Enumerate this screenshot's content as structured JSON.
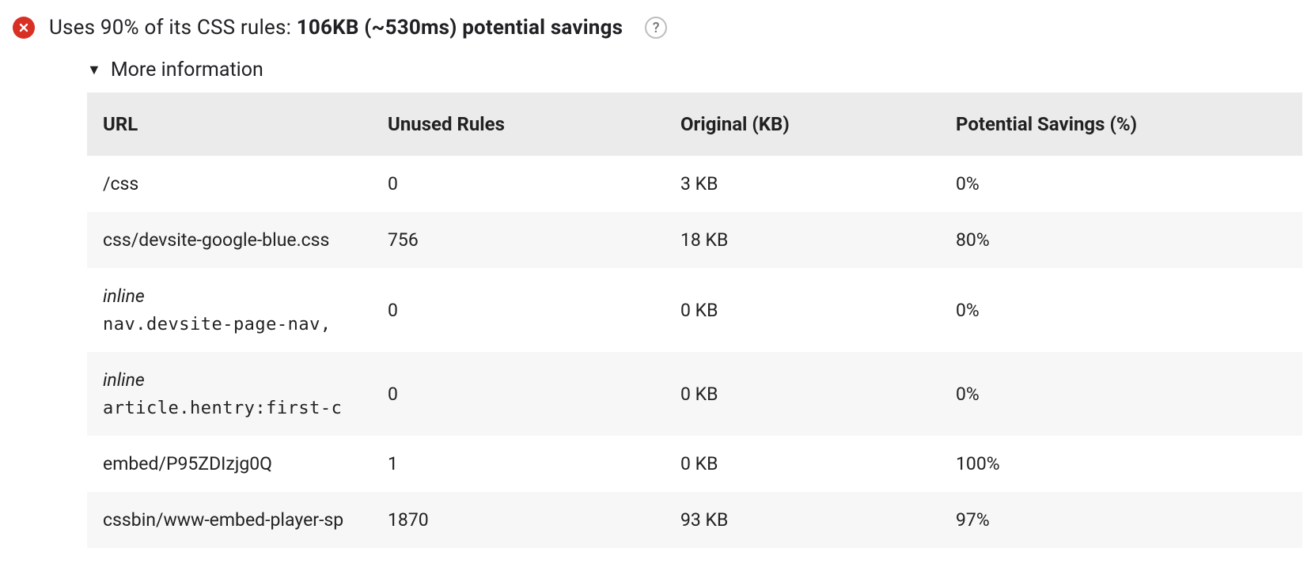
{
  "audit": {
    "title_prefix": "Uses 90% of its CSS rules: ",
    "title_bold": "106KB (~530ms) potential savings",
    "help_glyph": "?",
    "disclosure_label": "More information"
  },
  "table": {
    "headers": {
      "url": "URL",
      "unused": "Unused Rules",
      "original": "Original (KB)",
      "savings": "Potential Savings (%)"
    },
    "rows": [
      {
        "url": "/css",
        "unused": "0",
        "original": "3 KB",
        "savings": "0%"
      },
      {
        "url": "css/devsite-google-blue.css",
        "unused": "756",
        "original": "18 KB",
        "savings": "80%"
      },
      {
        "inline_label": "inline",
        "code": "nav.devsite-page-nav,",
        "unused": "0",
        "original": "0 KB",
        "savings": "0%"
      },
      {
        "inline_label": "inline",
        "code": "article.hentry:first-c",
        "unused": "0",
        "original": "0 KB",
        "savings": "0%"
      },
      {
        "url": "embed/P95ZDIzjg0Q",
        "unused": "1",
        "original": "0 KB",
        "savings": "100%"
      },
      {
        "url": "cssbin/www-embed-player-sp",
        "unused": "1870",
        "original": "93 KB",
        "savings": "97%"
      }
    ]
  }
}
